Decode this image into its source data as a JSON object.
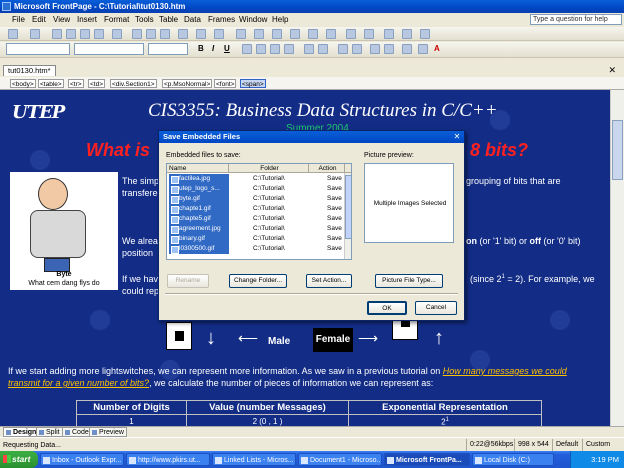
{
  "window": {
    "title": "Microsoft FrontPage - C:\\Tutorial\\tut0130.htm"
  },
  "menu": [
    "File",
    "Edit",
    "View",
    "Insert",
    "Format",
    "Tools",
    "Table",
    "Data",
    "Frames",
    "Window",
    "Help"
  ],
  "help_placeholder": "Type a question for help",
  "document_tab": "tut0130.htm*",
  "tag_selector": [
    "<body>",
    "<table>",
    "<tr>",
    "<td>",
    "<div.Section1>",
    "<p.MsoNormal>",
    "<font>",
    "<span>"
  ],
  "page": {
    "logo": "UTEP",
    "course_title": "CIS3355: Business Data Structures in C/C++",
    "semester": "Summer 2004",
    "question_left": "What is",
    "question_right": "8 bits?",
    "cartoon_caption_1": "Byte",
    "cartoon_caption_2": "What cem dang flys do",
    "line1_a": "The simp",
    "line1_b": "grouping of bits that are",
    "line2_a": "transfere",
    "line3_a": "We alrea",
    "line3_on": "on",
    "line3_mid": "(or '1' bit) or",
    "line3_off": "off",
    "line3_end": "(or '0' bit)",
    "line4_a": "position",
    "line5_a": "If we hav",
    "line5_b": "(since 2",
    "line5_sup": "1",
    "line5_c": "= 2).  For example, we",
    "line6_a": "could rep",
    "label_male": "Male",
    "label_female": "Female",
    "para1_a": "If we start adding more lightswitches, we can represent more information. As we saw in a previous tutorial on",
    "para1_link_1": "How many messages we could",
    "para1_link_2": "transmit for a given number of bits?",
    "para1_b": ", we calculate the number of pieces of information we can represent as:"
  },
  "table": {
    "headers": [
      "Number of Digits",
      "Value (number Messages)",
      "Exponential Representation"
    ],
    "row1": [
      "1",
      "2 (0 , 1 )",
      "2"
    ],
    "row1_sup": "1"
  },
  "dialog": {
    "title": "Save Embedded Files",
    "files_label": "Embedded files to save:",
    "columns": [
      "Name",
      "Folder",
      "Action"
    ],
    "files": [
      {
        "name": "factilea.jpg",
        "folder": "C:\\Tutorial\\",
        "action": "Save"
      },
      {
        "name": "utep_logo_s...",
        "folder": "C:\\Tutorial\\",
        "action": "Save"
      },
      {
        "name": "byte.gif",
        "folder": "C:\\Tutorial\\",
        "action": "Save"
      },
      {
        "name": "chapte1.gif",
        "folder": "C:\\Tutorial\\",
        "action": "Save"
      },
      {
        "name": "chapte5.gif",
        "folder": "C:\\Tutorial\\",
        "action": "Save"
      },
      {
        "name": "agreement.jpg",
        "folder": "C:\\Tutorial\\",
        "action": "Save"
      },
      {
        "name": "binary.gif",
        "folder": "C:\\Tutorial\\",
        "action": "Save"
      },
      {
        "name": "l0300500.gif",
        "folder": "C:\\Tutorial\\",
        "action": "Save"
      }
    ],
    "preview_label": "Picture preview:",
    "preview_text": "Multiple Images Selected",
    "rename_label": "Rename",
    "change_folder_label": "Change Folder...",
    "set_action_label": "Set Action...",
    "picture_file_type_label": "Picture File Type...",
    "ok_label": "OK",
    "cancel_label": "Cancel"
  },
  "view_tabs": [
    "Design",
    "Split",
    "Code",
    "Preview"
  ],
  "status": {
    "left": "Requesting Data...",
    "speed": "0:22@56kbps",
    "size": "998 x 544",
    "mode1": "Default",
    "mode2": "Custom"
  },
  "taskbar": {
    "start": "start",
    "tasks": [
      "Inbox - Outlook Expr...",
      "http://www.pkirs.ut...",
      "Linked Lists - Micros...",
      "Document1 - Microso...",
      "Microsoft FrontPa...",
      "Local Disk (C:)"
    ],
    "clock": "3:19 PM"
  }
}
